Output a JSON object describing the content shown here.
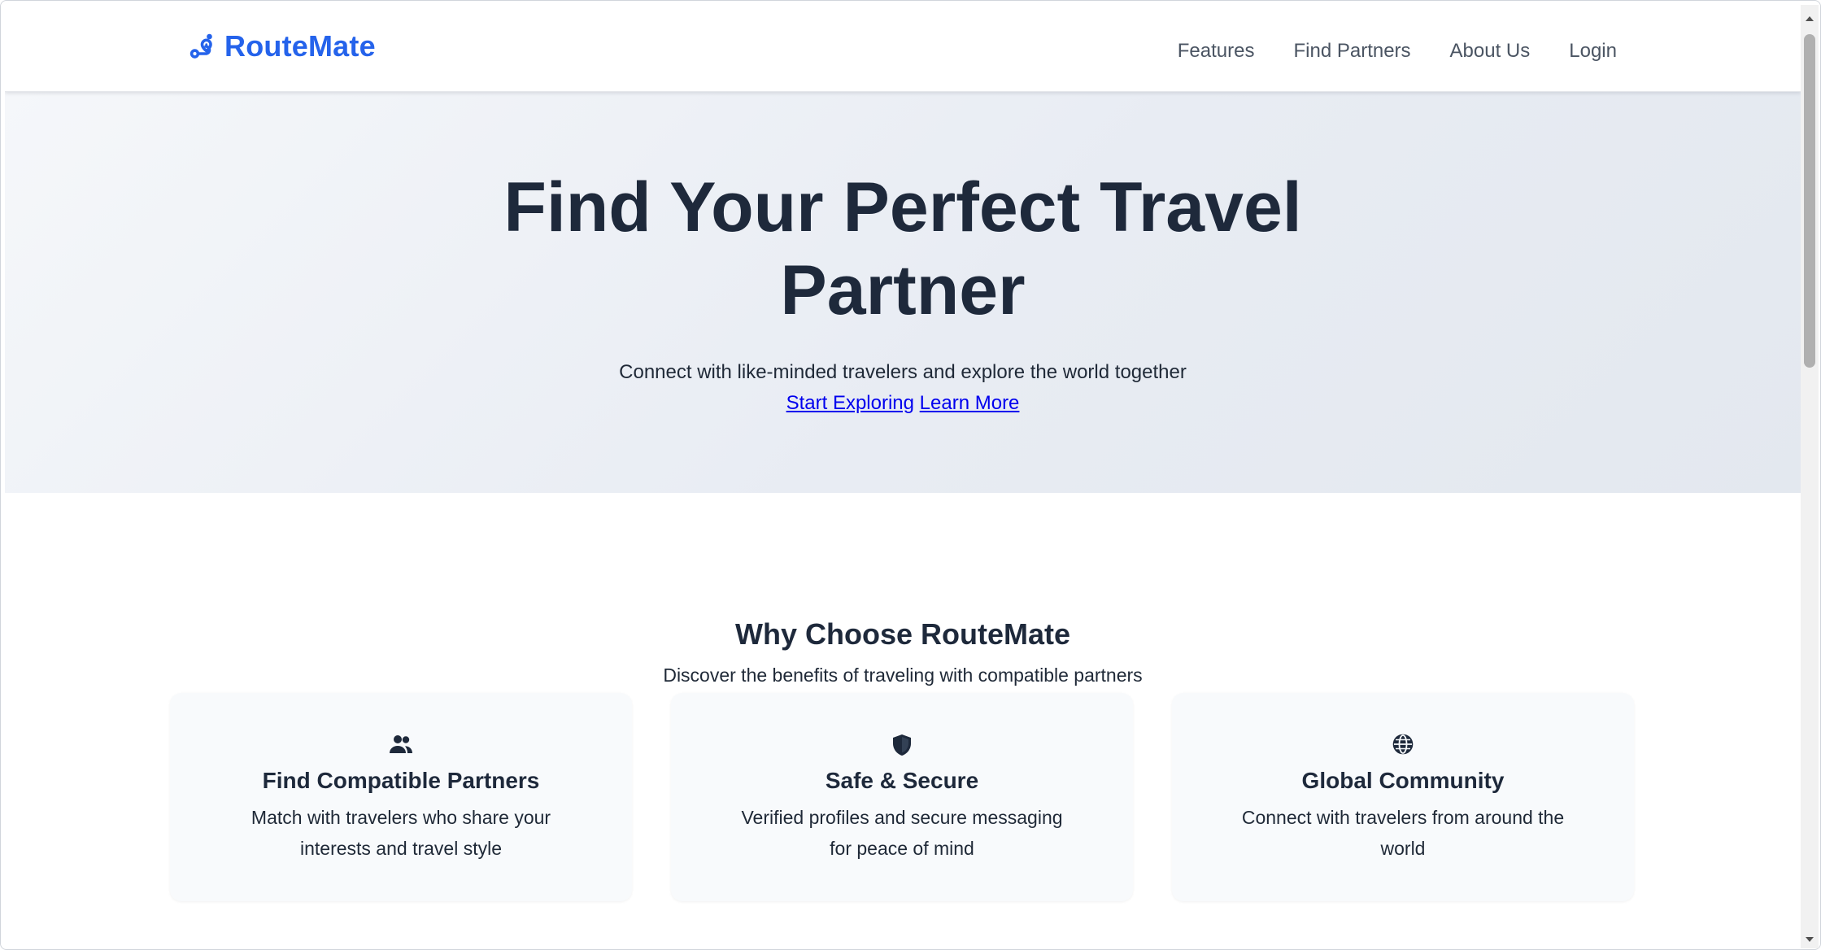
{
  "header": {
    "brand": "RouteMate",
    "brand_icon": "route-icon",
    "nav": [
      {
        "label": "Features"
      },
      {
        "label": "Find Partners"
      },
      {
        "label": "About Us"
      },
      {
        "label": "Login"
      }
    ]
  },
  "hero": {
    "title": "Find Your Perfect Travel Partner",
    "subtitle": "Connect with like-minded travelers and explore the world together",
    "cta_primary": "Start Exploring",
    "cta_secondary": "Learn More"
  },
  "features": {
    "title": "Why Choose RouteMate",
    "subtitle": "Discover the benefits of traveling with compatible partners",
    "cards": [
      {
        "icon": "users-icon",
        "title": "Find Compatible Partners",
        "text": "Match with travelers who share your interests and travel style"
      },
      {
        "icon": "shield-icon",
        "title": "Safe & Secure",
        "text": "Verified profiles and secure messaging for peace of mind"
      },
      {
        "icon": "globe-icon",
        "title": "Global Community",
        "text": "Connect with travelers from around the world"
      }
    ]
  },
  "colors": {
    "brand": "#2563eb",
    "text_dark": "#1e293b",
    "nav_text": "#4b5563",
    "link": "#0000ee",
    "card_bg": "#f8fafc"
  }
}
